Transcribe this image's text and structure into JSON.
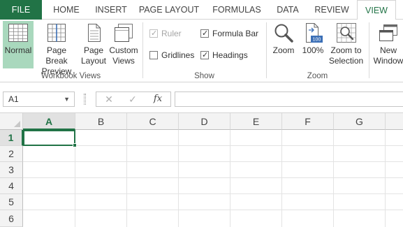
{
  "tabs": {
    "file": "FILE",
    "home": "HOME",
    "insert": "INSERT",
    "page_layout": "PAGE LAYOUT",
    "formulas": "FORMULAS",
    "data": "DATA",
    "review": "REVIEW",
    "view": "VIEW",
    "active": "VIEW"
  },
  "ribbon": {
    "workbook_views": {
      "label": "Workbook Views",
      "normal": "Normal",
      "page_break_line1": "Page Break",
      "page_break_line2": "Preview",
      "page_layout_line1": "Page",
      "page_layout_line2": "Layout",
      "custom_line1": "Custom",
      "custom_line2": "Views",
      "selected": "Normal"
    },
    "show": {
      "label": "Show",
      "ruler": "Ruler",
      "ruler_checked": true,
      "ruler_disabled": true,
      "formula_bar": "Formula Bar",
      "formula_bar_checked": true,
      "gridlines": "Gridlines",
      "gridlines_checked": false,
      "headings": "Headings",
      "headings_checked": true
    },
    "zoom": {
      "label": "Zoom",
      "zoom": "Zoom",
      "hundred": "100%",
      "hundred_icon_text": "100",
      "zoom_sel_line1": "Zoom to",
      "zoom_sel_line2": "Selection"
    },
    "window": {
      "new_window_line1": "New",
      "new_window_line2": "Window"
    }
  },
  "formula_bar": {
    "name_box": "A1",
    "cancel_symbol": "✕",
    "enter_symbol": "✓",
    "fx_symbol": "fx",
    "formula": ""
  },
  "sheet": {
    "columns": [
      "A",
      "B",
      "C",
      "D",
      "E",
      "F",
      "G"
    ],
    "rows": [
      "1",
      "2",
      "3",
      "4",
      "5",
      "6"
    ],
    "active_cell": "A1"
  },
  "colors": {
    "excel_green": "#217346",
    "selected_button": "#a9d8bd",
    "header_bg": "#f3f3f3"
  }
}
